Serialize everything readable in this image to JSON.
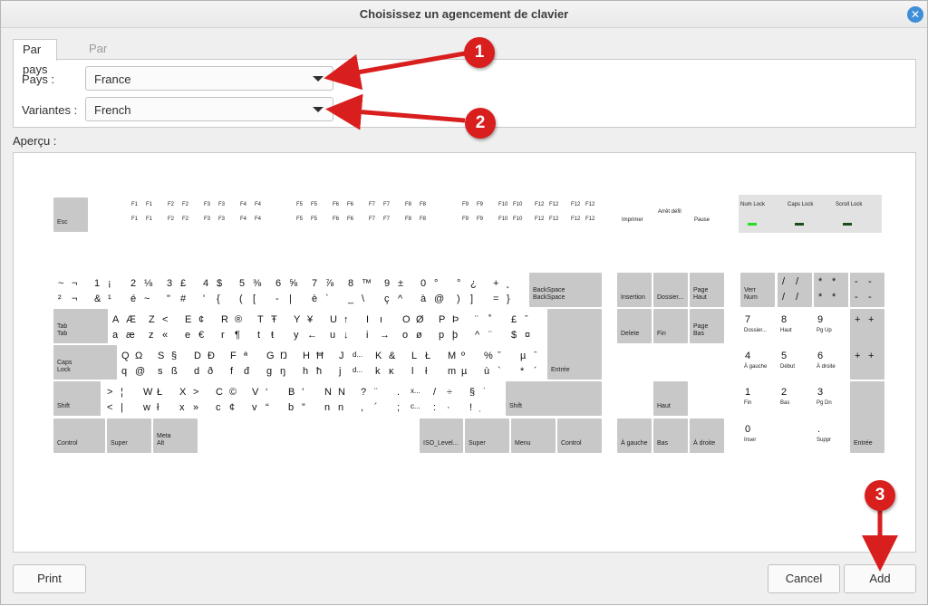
{
  "window": {
    "title": "Choisissez un agencement de clavier",
    "close_icon": "close-icon"
  },
  "tabs": [
    {
      "label": "Par pays",
      "active": true
    },
    {
      "label": "Par langue",
      "active": false
    }
  ],
  "country": {
    "label": "Pays :",
    "value": "France"
  },
  "variant": {
    "label": "Variantes :",
    "value": "French"
  },
  "preview": {
    "label": "Aperçu :"
  },
  "keyboard": {
    "esc": "Esc",
    "function_row": [
      [
        "F1",
        "F1"
      ],
      [
        "F2",
        "F2"
      ],
      [
        "F3",
        "F3"
      ],
      [
        "F4",
        "F4"
      ],
      [
        "F5",
        "F5"
      ],
      [
        "F6",
        "F6"
      ],
      [
        "F7",
        "F7"
      ],
      [
        "F8",
        "F8"
      ],
      [
        "F9",
        "F9"
      ],
      [
        "F10",
        "F10"
      ],
      [
        "F12",
        "F12"
      ],
      [
        "F12",
        "F12"
      ]
    ],
    "system_keys": {
      "print": "Imprimer",
      "scroll": "Arrêt défil",
      "pause": "Pause"
    },
    "lock_indicators": [
      {
        "label": "Num Lock",
        "on": true
      },
      {
        "label": "Caps Lock",
        "on": false
      },
      {
        "label": "Scroll Lock",
        "on": false
      }
    ],
    "number_row": [
      [
        "~",
        "¬",
        "²",
        "¬"
      ],
      [
        "1",
        "¡",
        "&",
        "¹"
      ],
      [
        "2",
        "⅛",
        "é",
        "~"
      ],
      [
        "3",
        "£",
        "\"",
        "#"
      ],
      [
        "4",
        "$",
        "'",
        "{"
      ],
      [
        "5",
        "⅜",
        "(",
        "["
      ],
      [
        "6",
        "⅝",
        "-",
        "|"
      ],
      [
        "7",
        "⅞",
        "è",
        "`"
      ],
      [
        "8",
        "™",
        "_",
        "\\"
      ],
      [
        "9",
        "±",
        "ç",
        "^"
      ],
      [
        "0",
        "°",
        "à",
        "@"
      ],
      [
        "°",
        "¿",
        ")",
        "]"
      ],
      [
        "+",
        "˛",
        "=",
        "}"
      ]
    ],
    "backspace": [
      "BackSpace",
      "BackSpace"
    ],
    "tab_label": [
      "Tab",
      "Tab"
    ],
    "row_q": [
      [
        "A",
        "Æ",
        "a",
        "æ"
      ],
      [
        "Z",
        "<",
        "z",
        "«"
      ],
      [
        "E",
        "¢",
        "e",
        "€"
      ],
      [
        "R",
        "®",
        "r",
        "¶"
      ],
      [
        "T",
        "Ŧ",
        "t",
        "ŧ"
      ],
      [
        "Y",
        "¥",
        "y",
        "←"
      ],
      [
        "U",
        "↑",
        "u",
        "↓"
      ],
      [
        "I",
        "ı",
        "i",
        "→"
      ],
      [
        "O",
        "Ø",
        "o",
        "ø"
      ],
      [
        "P",
        "Þ",
        "p",
        "þ"
      ],
      [
        "¨",
        "˚",
        "^",
        "¨"
      ],
      [
        "£",
        "ˇ",
        "$",
        "¤"
      ]
    ],
    "enter": "Entrée",
    "caps_label": [
      "Caps",
      "Lock"
    ],
    "row_a": [
      [
        "Q",
        "Ω",
        "q",
        "@"
      ],
      [
        "S",
        "§",
        "s",
        "ß"
      ],
      [
        "D",
        "Ð",
        "d",
        "ð"
      ],
      [
        "F",
        "ª",
        "f",
        "đ"
      ],
      [
        "G",
        "Ŋ",
        "g",
        "ŋ"
      ],
      [
        "H",
        "Ħ",
        "h",
        "ħ"
      ],
      [
        "J",
        "d...",
        "j",
        "d..."
      ],
      [
        "K",
        "&",
        "k",
        "ĸ"
      ],
      [
        "L",
        "Ł",
        "l",
        "ł"
      ],
      [
        "M",
        "º",
        "m",
        "µ"
      ],
      [
        "%",
        "ˇ",
        "ù",
        "`"
      ],
      [
        "µ",
        "ˉ",
        "*",
        "´"
      ]
    ],
    "shift_label": "Shift",
    "row_z": [
      [
        ">",
        "¦",
        "<",
        "|"
      ],
      [
        "W",
        "Ł",
        "w",
        "ł"
      ],
      [
        "X",
        ">",
        "x",
        "»"
      ],
      [
        "C",
        "©",
        "c",
        "¢"
      ],
      [
        "V",
        "‘",
        "v",
        "“"
      ],
      [
        "B",
        "’",
        "b",
        "”"
      ],
      [
        "N",
        "N",
        "n",
        "n"
      ],
      [
        "?",
        "¨",
        ",",
        "´"
      ],
      [
        ".",
        "x...",
        ";",
        "c..."
      ],
      [
        "/",
        "÷",
        ":",
        "·"
      ],
      [
        "§",
        "˙",
        "!",
        "̣"
      ]
    ],
    "bottom_row": {
      "control": "Control",
      "super": "Super",
      "meta": "Meta",
      "alt": "Alt",
      "iso": "ISO_Level...",
      "super2": "Super",
      "menu": "Menu",
      "control2": "Control"
    },
    "nav": {
      "insertion": "Insertion",
      "dossier": "Dossier...",
      "page_haut": "Page Haut",
      "delete": "Delete",
      "fin": "Fin",
      "page_bas": "Page Bas",
      "haut": "Haut",
      "a_gauche": "À gauche",
      "bas": "Bas",
      "a_droite": "À droite"
    },
    "numpad": {
      "verr_num": "Verr Num",
      "div": [
        "/",
        "/"
      ],
      "mul": [
        "*",
        "*",
        "*",
        "*"
      ],
      "minus": [
        "-",
        "-",
        "-",
        "-"
      ],
      "k7": [
        "7",
        "Dossier..."
      ],
      "k8": [
        "8",
        "Haut"
      ],
      "k9": [
        "9",
        "Pg Up"
      ],
      "plus": [
        "+",
        "+",
        "+",
        "+"
      ],
      "k4": [
        "4",
        "À gauche"
      ],
      "k5": [
        "5",
        "Début"
      ],
      "k6": [
        "6",
        "À droite"
      ],
      "k1": [
        "1",
        "Fin"
      ],
      "k2": [
        "2",
        "Bas"
      ],
      "k3": [
        "3",
        "Pg Dn"
      ],
      "k0": [
        "0",
        "Inser"
      ],
      "dot": [
        ".",
        "Suppr"
      ],
      "enter": "Entrée"
    }
  },
  "buttons": {
    "print": "Print",
    "cancel": "Cancel",
    "add": "Add"
  },
  "callouts": [
    "1",
    "2",
    "3"
  ],
  "colors": {
    "callout": "#d91e1e",
    "led_on": "#25dd25",
    "led_off": "#1c4d1c",
    "close": "#3f8ed8"
  }
}
